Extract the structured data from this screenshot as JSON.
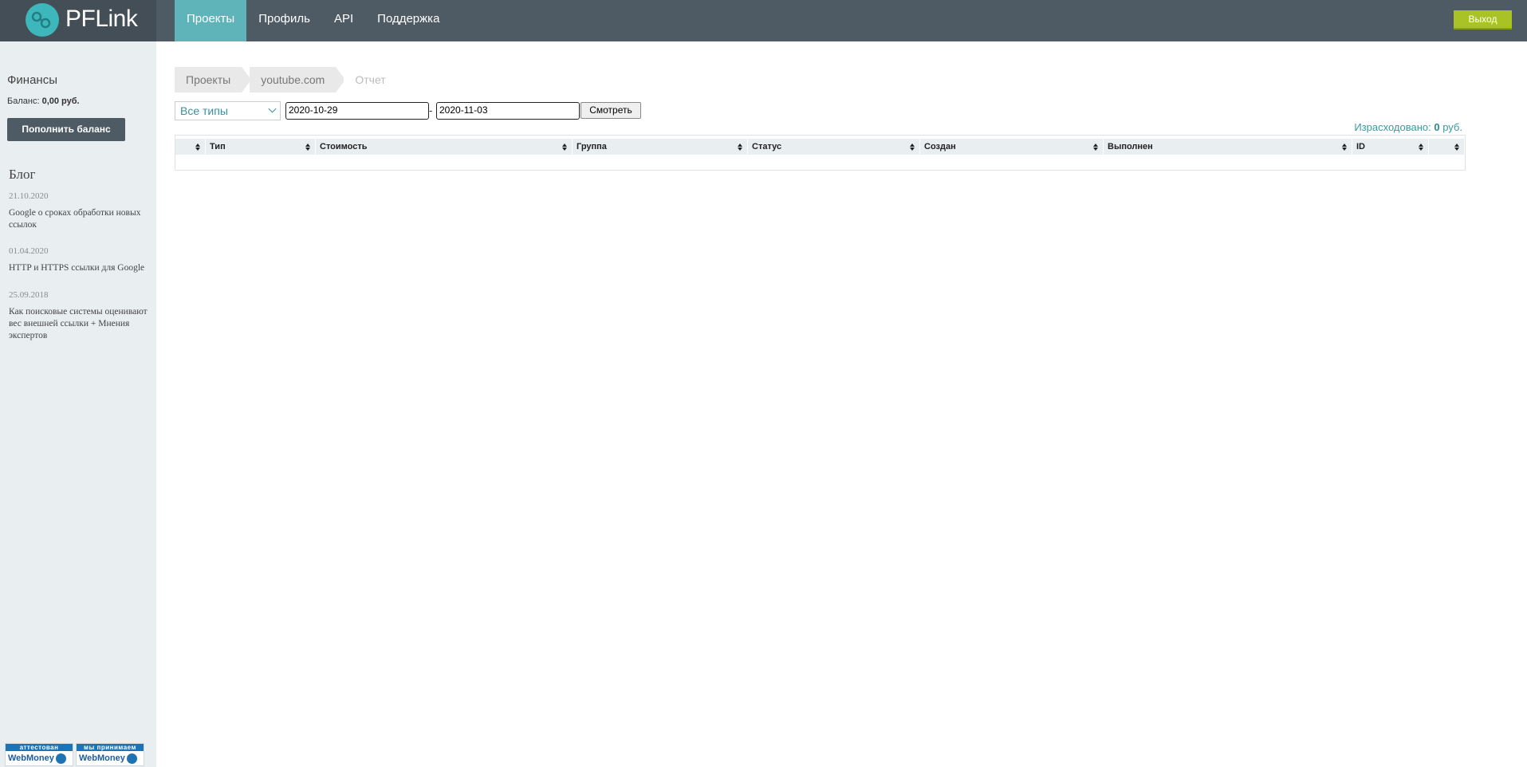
{
  "app": {
    "logo_text": "PFLink"
  },
  "nav": {
    "items": [
      {
        "label": "Проекты",
        "active": true
      },
      {
        "label": "Профиль",
        "active": false
      },
      {
        "label": "API",
        "active": false
      },
      {
        "label": "Поддержка",
        "active": false
      }
    ],
    "logout_label": "Выход"
  },
  "sidebar": {
    "finance_title": "Финансы",
    "balance_label": "Баланс:",
    "balance_value": "0,00 руб.",
    "topup_label": "Пополнить баланс",
    "blog_title": "Блог",
    "blog": [
      {
        "date": "21.10.2020",
        "title": "Google о сроках обработки новых ссылок"
      },
      {
        "date": "01.04.2020",
        "title": "HTTP и HTTPS ссылки для Google"
      },
      {
        "date": "25.09.2018",
        "title": "Как поисковые системы оценивают вес внешней ссылки + Мнения экспертов"
      }
    ],
    "badges": [
      {
        "top": "аттестован",
        "bottom": "WebMoney"
      },
      {
        "top": "мы принимаем",
        "bottom": "WebMoney"
      }
    ]
  },
  "breadcrumb": [
    "Проекты",
    "youtube.com",
    "Отчет"
  ],
  "filters": {
    "type_selected": "Все типы",
    "date_from": "2020-10-29",
    "date_sep": "-",
    "date_to": "2020-11-03",
    "view_label": "Смотреть"
  },
  "summary": {
    "spent_label": "Израсходовано:",
    "spent_value": "0",
    "spent_unit": "руб."
  },
  "table": {
    "columns": [
      "",
      "Тип",
      "Стоимость",
      "Группа",
      "Статус",
      "Создан",
      "Выполнен",
      "ID",
      ""
    ]
  },
  "colors": {
    "topbar": "#4e5b65",
    "accent": "#5fb4b9",
    "logout": "#a9c226",
    "sidebar": "#e9eef0"
  }
}
